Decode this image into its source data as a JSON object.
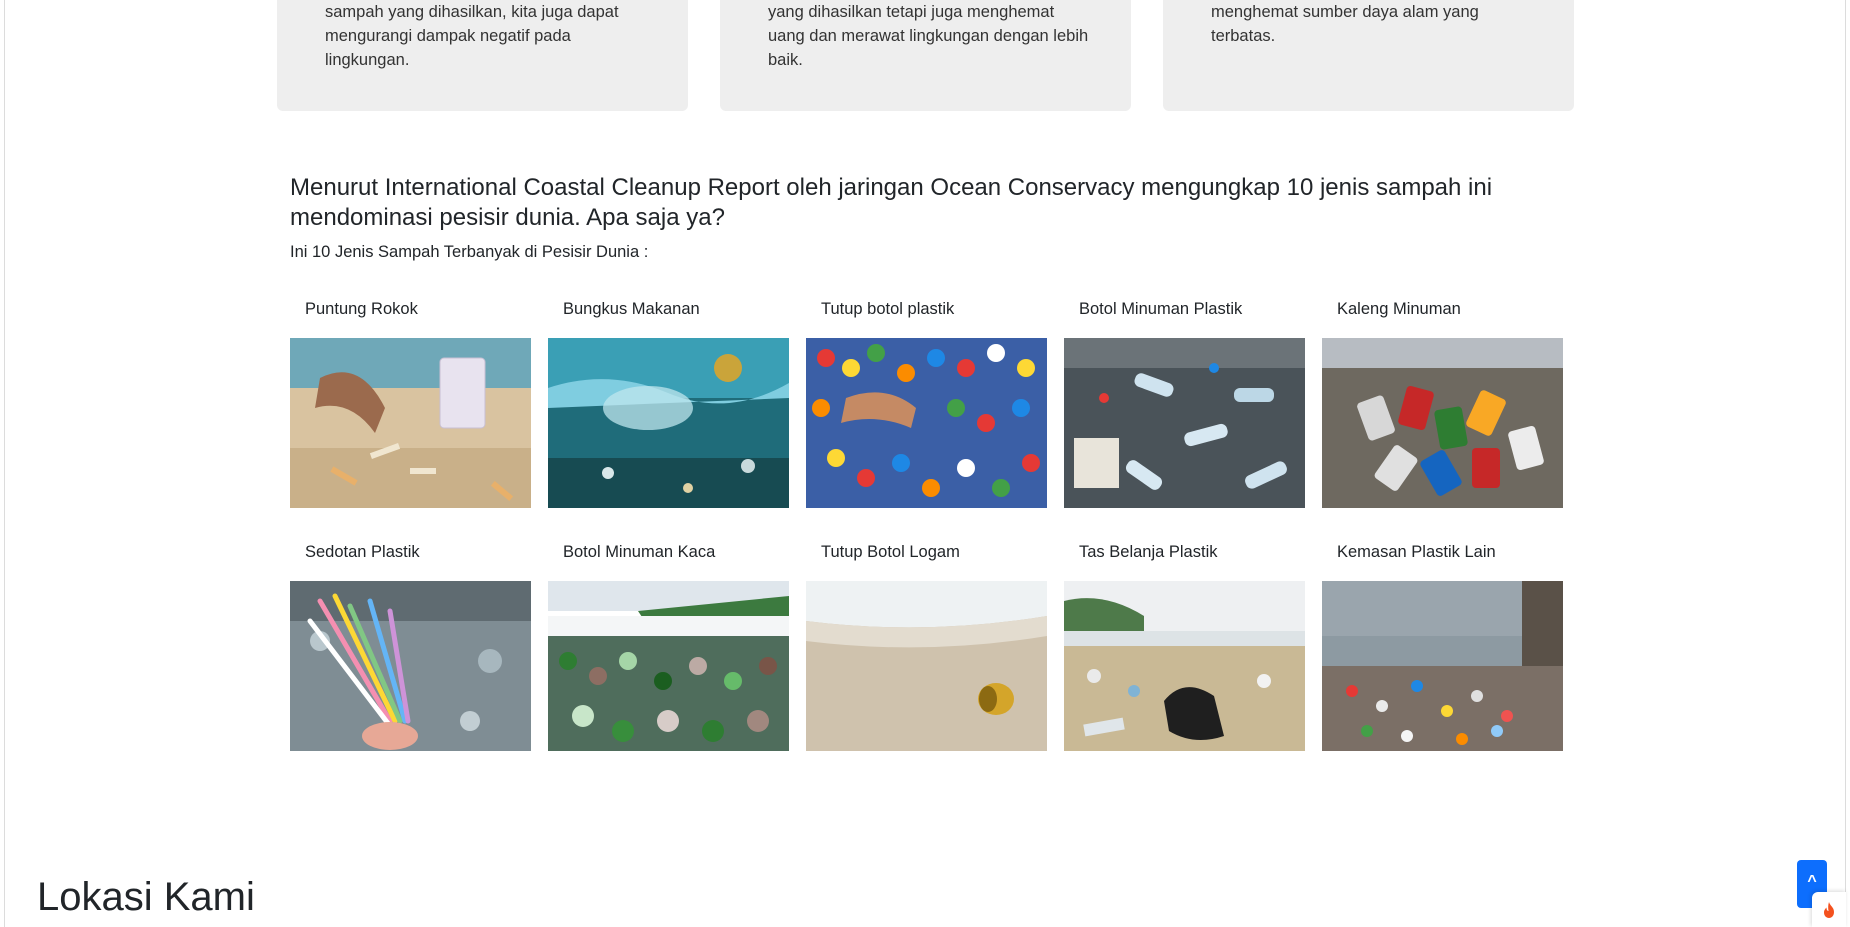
{
  "cards": [
    {
      "lines": [
        "sampah yang dihasilkan, kita juga dapat",
        "mengurangi dampak negatif pada",
        "lingkungan."
      ]
    },
    {
      "lines": [
        "yang dihasilkan tetapi juga menghemat",
        "uang dan merawat lingkungan dengan lebih",
        "baik."
      ]
    },
    {
      "lines": [
        "menghemat sumber daya alam yang",
        "terbatas."
      ]
    }
  ],
  "section": {
    "heading": "Menurut International Coastal Cleanup Report oleh jaringan Ocean Conservacy mengungkap 10 jenis sampah ini mendominasi pesisir dunia. Apa saja ya?",
    "subheading": "Ini 10 Jenis Sampah Terbanyak di Pesisir Dunia :"
  },
  "items": [
    {
      "label": "Puntung Rokok",
      "icon": "cigarette-butts-photo"
    },
    {
      "label": "Bungkus Makanan",
      "icon": "food-wrapper-photo"
    },
    {
      "label": "Tutup botol plastik",
      "icon": "plastic-caps-photo"
    },
    {
      "label": "Botol Minuman Plastik",
      "icon": "plastic-bottles-photo"
    },
    {
      "label": "Kaleng Minuman",
      "icon": "drink-cans-photo"
    },
    {
      "label": "Sedotan Plastik",
      "icon": "plastic-straws-photo"
    },
    {
      "label": "Botol Minuman Kaca",
      "icon": "glass-bottles-photo"
    },
    {
      "label": "Tutup Botol Logam",
      "icon": "metal-cap-photo"
    },
    {
      "label": "Tas Belanja Plastik",
      "icon": "plastic-bag-photo"
    },
    {
      "label": "Kemasan Plastik Lain",
      "icon": "plastic-packaging-photo"
    }
  ],
  "footer": {
    "lokasi_title": "Lokasi Kami",
    "scroll_top_label": "^"
  },
  "colors": {
    "card_bg": "#eeeeee",
    "accent": "#0d6efd"
  }
}
